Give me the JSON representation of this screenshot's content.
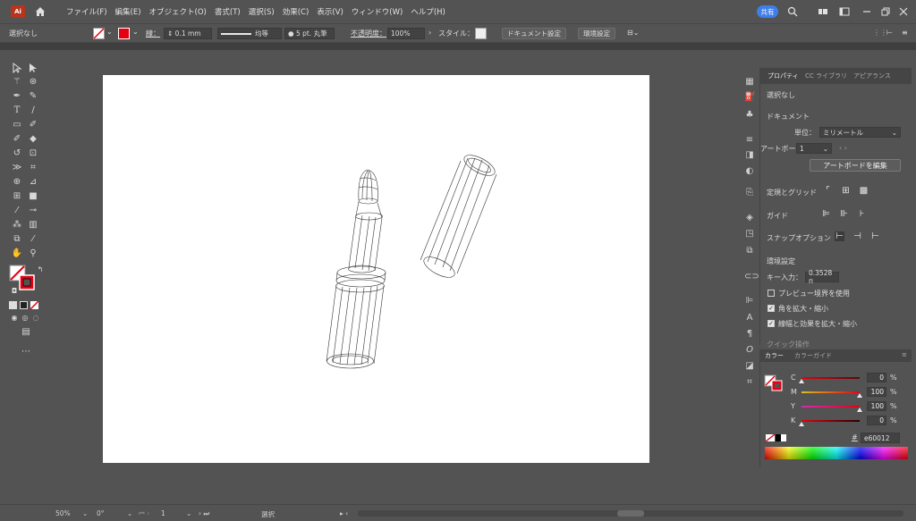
{
  "app": {
    "logo_text": "Ai"
  },
  "menu": {
    "items": [
      "ファイル(F)",
      "編集(E)",
      "オブジェクト(O)",
      "書式(T)",
      "選択(S)",
      "効果(C)",
      "表示(V)",
      "ウィンドウ(W)",
      "ヘルプ(H)"
    ],
    "share_label": "共有"
  },
  "control": {
    "selection": "選択なし",
    "stroke_label": "線：",
    "stroke_width": "0.1 mm",
    "stroke_profile": "均等",
    "brush": "5 pt. 丸筆",
    "opacity_label": "不透明度：",
    "opacity_value": "100%",
    "style_label": "スタイル：",
    "doc_setup": "ドキュメント設定",
    "prefs": "環境設定"
  },
  "properties": {
    "tabs": [
      "プロパティ",
      "CC ライブラリ",
      "アピアランス"
    ],
    "selection": "選択なし",
    "document_header": "ドキュメント",
    "unit_label": "単位：",
    "unit_value": "ミリメートル",
    "artboard_label": "アートボード：",
    "artboard_value": "1",
    "edit_artboard_button": "アートボードを編集",
    "rulers_grid": "定規とグリッド",
    "guides": "ガイド",
    "snap_options": "スナップオプション",
    "preferences_header": "環境設定",
    "key_input_label": "キー入力：",
    "key_input_value": "0.3528 п",
    "checkbox_preview": "プレビュー境界を使用",
    "checkbox_corners": "角を拡大・縮小",
    "checkbox_strokes": "線幅と効果を拡大・縮小",
    "quick_actions": "クイック操作"
  },
  "color_panel": {
    "tabs": [
      "カラー",
      "カラーガイド"
    ],
    "channels": [
      {
        "label": "C",
        "value": "0",
        "unit": "%"
      },
      {
        "label": "M",
        "value": "100",
        "unit": "%"
      },
      {
        "label": "Y",
        "value": "100",
        "unit": "%"
      },
      {
        "label": "K",
        "value": "0",
        "unit": "%"
      }
    ],
    "hex": "e60012",
    "accent": "#e60012"
  },
  "status": {
    "zoom": "50%",
    "rotation": "0°",
    "artboard_nav": "1",
    "tool_name": "選択"
  },
  "colors": {
    "fill_red": "#e60012",
    "share_blue": "#3f7ee8",
    "panel_bg": "#535353"
  }
}
